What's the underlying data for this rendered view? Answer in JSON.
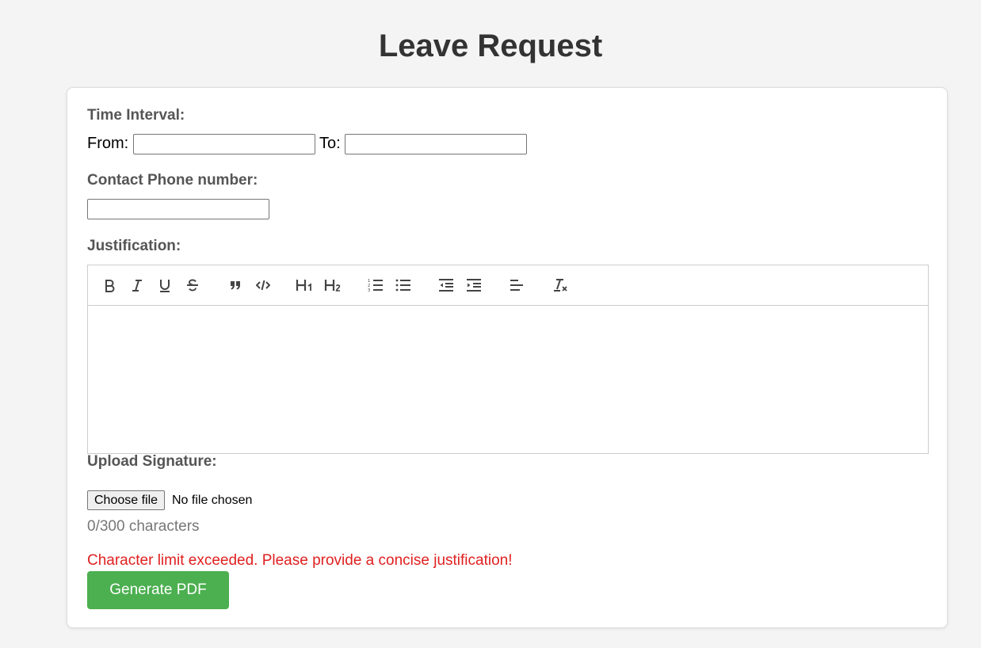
{
  "page": {
    "title": "Leave Request"
  },
  "form": {
    "time_interval_label": "Time Interval:",
    "from_label": "From:",
    "to_label": "To:",
    "from_value": "",
    "to_value": "",
    "phone_label": "Contact Phone number:",
    "phone_value": "",
    "justification_label": "Justification:",
    "signature_label": "Upload Signature:",
    "file_button_label": "Choose file",
    "file_status": "No file chosen",
    "char_count": "0/300 characters",
    "error_message": "Character limit exceeded. Please provide a concise justification!",
    "submit_label": "Generate PDF"
  },
  "toolbar": {
    "buttons": [
      "bold-icon",
      "italic-icon",
      "underline-icon",
      "strikethrough-icon",
      "blockquote-icon",
      "code-block-icon",
      "heading-1-icon",
      "heading-2-icon",
      "ordered-list-icon",
      "bullet-list-icon",
      "outdent-icon",
      "indent-icon",
      "align-left-icon",
      "clear-formatting-icon"
    ]
  },
  "colors": {
    "accent": "#4caf50",
    "error": "#e02020",
    "background": "#f4f4f4"
  }
}
